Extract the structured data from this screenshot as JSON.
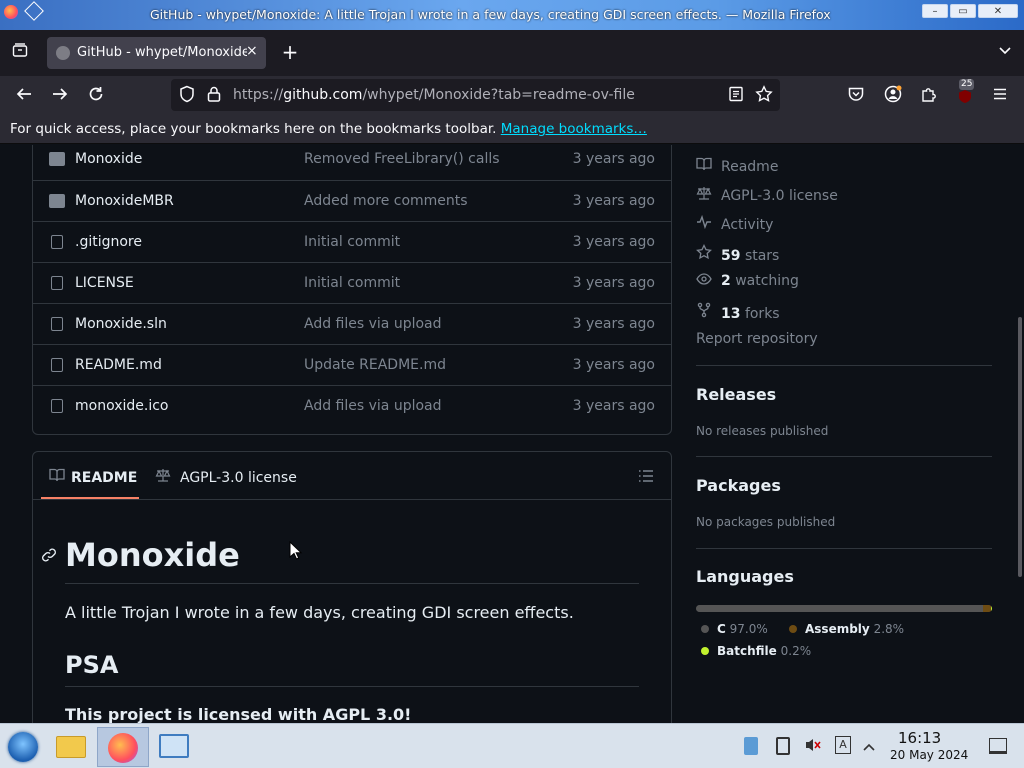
{
  "window": {
    "title": "GitHub - whypet/Monoxide: A little Trojan I wrote in a few days, creating GDI screen effects. — Mozilla Firefox"
  },
  "tab": {
    "label": "GitHub - whypet/Monoxide",
    "close": "×",
    "new_tab": "+"
  },
  "nav": {
    "url_prefix": "https://",
    "url_domain": "github.com",
    "url_path": "/whypet/Monoxide?tab=readme-ov-file",
    "extension_badge": "25"
  },
  "bookmarks": {
    "message": "For quick access, place your bookmarks here on the bookmarks toolbar.",
    "link": "Manage bookmarks…"
  },
  "files": [
    {
      "type": "folder",
      "name": "Monoxide",
      "message": "Removed FreeLibrary() calls",
      "time": "3 years ago"
    },
    {
      "type": "folder",
      "name": "MonoxideMBR",
      "message": "Added more comments",
      "time": "3 years ago"
    },
    {
      "type": "file",
      "name": ".gitignore",
      "message": "Initial commit",
      "time": "3 years ago"
    },
    {
      "type": "file",
      "name": "LICENSE",
      "message": "Initial commit",
      "time": "3 years ago"
    },
    {
      "type": "file",
      "name": "Monoxide.sln",
      "message": "Add files via upload",
      "time": "3 years ago"
    },
    {
      "type": "file",
      "name": "README.md",
      "message": "Update README.md",
      "time": "3 years ago"
    },
    {
      "type": "file",
      "name": "monoxide.ico",
      "message": "Add files via upload",
      "time": "3 years ago"
    }
  ],
  "readme": {
    "tab_readme": "README",
    "tab_license": "AGPL-3.0 license",
    "h1": "Monoxide",
    "intro": "A little Trojan I wrote in a few days, creating GDI screen effects.",
    "h2": "PSA",
    "license_note": "This project is licensed with AGPL 3.0!"
  },
  "sidebar": {
    "readme": "Readme",
    "license": "AGPL-3.0 license",
    "activity": "Activity",
    "stars_count": "59",
    "stars_label": "stars",
    "watching_count": "2",
    "watching_label": "watching",
    "forks_count": "13",
    "forks_label": "forks",
    "report": "Report repository",
    "releases_title": "Releases",
    "releases_empty": "No releases published",
    "packages_title": "Packages",
    "packages_empty": "No packages published",
    "languages_title": "Languages",
    "languages": [
      {
        "name": "C",
        "percent": "97.0%",
        "value": 97.0,
        "color": "#555555"
      },
      {
        "name": "Assembly",
        "percent": "2.8%",
        "value": 2.8,
        "color": "#6E4C13"
      },
      {
        "name": "Batchfile",
        "percent": "0.2%",
        "value": 0.2,
        "color": "#C1F12E"
      }
    ]
  },
  "taskbar": {
    "time": "16:13",
    "date": "20 May 2024"
  },
  "colors": {
    "accent_link": "#00ddff",
    "tab_underline": "#f78166",
    "page_bg": "#0d1117"
  }
}
